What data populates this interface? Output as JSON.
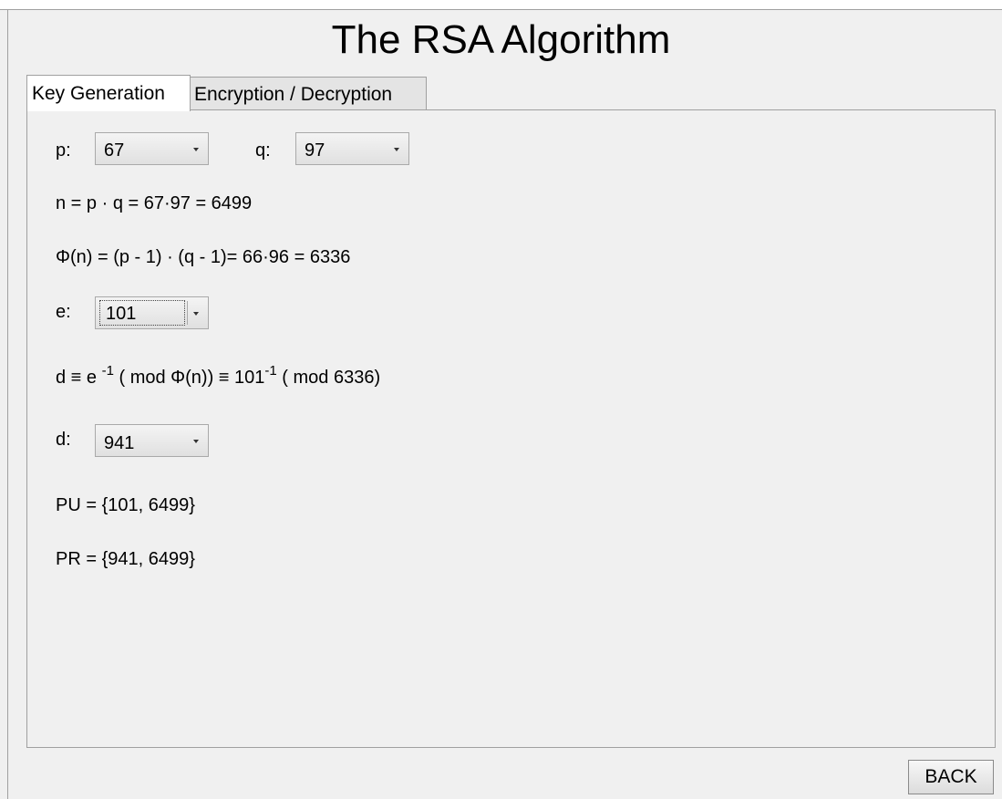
{
  "window": {
    "title": "The RSA Algorithm"
  },
  "tabs": [
    {
      "label": "Key Generation",
      "active": true
    },
    {
      "label": "Encryption / Decryption",
      "active": false
    }
  ],
  "key_generation": {
    "p_label": "p:",
    "p_value": "67",
    "q_label": "q:",
    "q_value": "97",
    "n_equation": "n = p · q = 67·97 = 6499",
    "phi_equation": "Φ(n) = (p - 1) · (q - 1)= 66·96 = 6336",
    "e_label": "e:",
    "e_value": "101",
    "d_formula": {
      "part1": "d ≡ e ",
      "exp1": "-1",
      "part2": " ( mod Φ(n)) ≡ 101",
      "exp2": "-1",
      "part3": " ( mod 6336)"
    },
    "d_label": "d:",
    "d_value": "941",
    "public_key": "PU = {101, 6499}",
    "private_key": "PR = {941, 6499}"
  },
  "footer": {
    "back_label": "BACK"
  }
}
